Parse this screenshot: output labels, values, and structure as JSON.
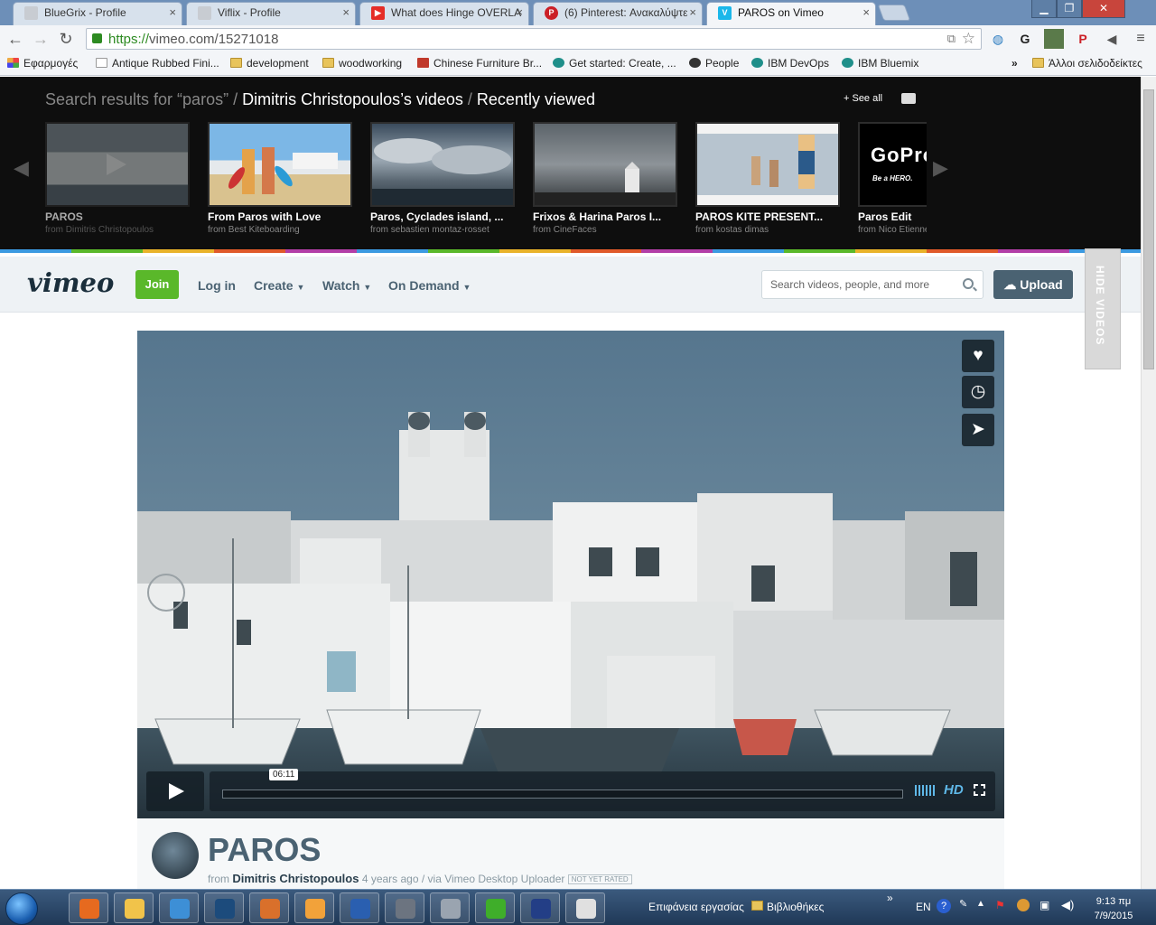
{
  "browser": {
    "tabs": [
      {
        "title": "BlueGrix - Profile",
        "icon_color": "#c8ccd2"
      },
      {
        "title": "Viflix - Profile",
        "icon_color": "#c8ccd2"
      },
      {
        "title": "What does Hinge OVERLA",
        "icon_color": "#e52d27"
      },
      {
        "title": "(6) Pinterest: Ανακαλύψτε",
        "icon_color": "#cb2027"
      },
      {
        "title": "PAROS on Vimeo",
        "icon_color": "#1ab7ea"
      }
    ],
    "url_scheme": "https://",
    "url_rest": "vimeo.com/15271018",
    "bookmarks": [
      {
        "label": "Εφαρμογές",
        "type": "apps"
      },
      {
        "label": "Antique Rubbed Fini...",
        "type": "page"
      },
      {
        "label": "development",
        "type": "folder"
      },
      {
        "label": "woodworking",
        "type": "folder"
      },
      {
        "label": "Chinese Furniture Br...",
        "type": "page"
      },
      {
        "label": "Get started: Create, ...",
        "type": "page"
      },
      {
        "label": "People",
        "type": "page"
      },
      {
        "label": "IBM DevOps",
        "type": "page"
      },
      {
        "label": "IBM Bluemix",
        "type": "page"
      }
    ],
    "bookmarks_more": "»",
    "other_bookmarks": "Άλλοι σελιδοδείκτες"
  },
  "recent": {
    "crumb_search": "Search results for “paros”",
    "crumb_sep": "/",
    "crumb_user": "Dimitris Christopoulos’s videos",
    "crumb_recent": "Recently viewed",
    "see_all": "+ See all",
    "videos": [
      {
        "title": "PAROS",
        "from": "from Dimitris Christopoulos"
      },
      {
        "title": "From Paros with Love",
        "from": "from Best Kiteboarding"
      },
      {
        "title": "Paros, Cyclades island, ...",
        "from": "from sebastien montaz-rosset"
      },
      {
        "title": "Frixos & Harina Paros I...",
        "from": "from CineFaces"
      },
      {
        "title": "PAROS KITE PRESENT...",
        "from": "from kostas dimas"
      },
      {
        "title": "Paros Edit",
        "from": "from Nico Etienne"
      }
    ],
    "thumb_text_gopro": "GoPro",
    "thumb_text_hero": "Be a HERO.",
    "rainbow": [
      "#3b9ae1",
      "#5ab82a",
      "#e9b32a",
      "#e05a2a",
      "#b33ea7",
      "#3b9ae1",
      "#5ab82a",
      "#e9b32a",
      "#e05a2a",
      "#b33ea7",
      "#3b9ae1",
      "#5ab82a",
      "#e9b32a",
      "#e05a2a",
      "#b33ea7",
      "#3b9ae1"
    ]
  },
  "vimeo": {
    "logo": "vimeo",
    "join": "Join",
    "login": "Log in",
    "create": "Create",
    "watch": "Watch",
    "on_demand": "On Demand",
    "search_placeholder": "Search videos, people, and more",
    "upload": "Upload",
    "hide_videos": "HIDE VIDEOS"
  },
  "player": {
    "time": "06:11",
    "hd": "HD"
  },
  "video": {
    "title": "PAROS",
    "from_label": "from",
    "author": "Dimitris Christopoulos",
    "meta": "4 years ago / via Vimeo Desktop Uploader",
    "rating": "NOT YET RATED"
  },
  "taskbar": {
    "desktop": "Επιφάνεια εργασίας",
    "library": "Βιβλιοθήκες",
    "lang": "EN",
    "time": "9:13 πμ",
    "date": "7/9/2015",
    "apps": [
      "#e66a1f",
      "#f1c34a",
      "#3d8fd6",
      "#1c4b7c",
      "#d9702b",
      "#f2a23a",
      "#2a5fb0",
      "#6c7480",
      "#9aa4b0",
      "#3fae2a",
      "#233e86",
      "#e0e0e0"
    ]
  }
}
